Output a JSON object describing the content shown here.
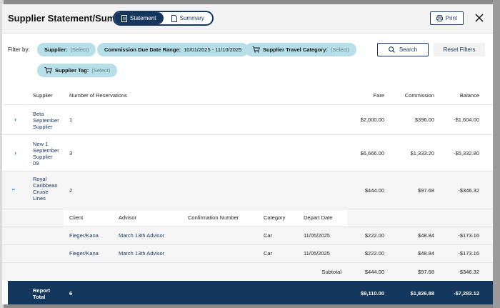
{
  "header": {
    "title": "Supplier Statement/Summary",
    "tabs": [
      {
        "label": "Statement",
        "active": true
      },
      {
        "label": "Summary",
        "active": false
      }
    ],
    "print_label": "Print"
  },
  "filters": {
    "label": "Filter by:",
    "supplier": {
      "label": "Supplier:",
      "value": "(Select)"
    },
    "date_range": {
      "label": "Commission Due Date Range:",
      "value": "10/01/2025 - 11/10/2025"
    },
    "travel_category": {
      "label": "Supplier Travel Category:",
      "value": "(Select)"
    },
    "tag": {
      "label": "Supplier Tag:",
      "value": "(Select)"
    },
    "search_label": "Search",
    "reset_label": "Reset Filters"
  },
  "table": {
    "columns": {
      "supplier": "Supplier",
      "reservations": "Number of Reservations",
      "fare": "Fare",
      "commission": "Commission",
      "balance": "Balance"
    },
    "rows": [
      {
        "supplier": [
          "Beta",
          "September",
          "Supplier"
        ],
        "reservations": "1",
        "fare": "$2,000.00",
        "commission": "$396.00",
        "balance": "-$1,604.00"
      },
      {
        "supplier": [
          "New 1",
          "September",
          "Supplier",
          "09"
        ],
        "reservations": "3",
        "fare": "$6,666.00",
        "commission": "$1,333.20",
        "balance": "-$5,332.80"
      },
      {
        "supplier": [
          "Royal",
          "Caribbean",
          "Cruise",
          "Lines"
        ],
        "reservations": "2",
        "fare": "$444.00",
        "commission": "$97.68",
        "balance": "-$346.32"
      }
    ],
    "detail": {
      "columns": {
        "client": "Client",
        "advisor": "Advisor",
        "confirmation": "Confirmation Number",
        "category": "Category",
        "depart": "Depart Date"
      },
      "rows": [
        {
          "client": "Fieger/Kana",
          "advisor": "March 13th Advisor",
          "confirmation": "",
          "category": "Car",
          "depart": "11/05/2025",
          "fare": "$222.00",
          "commission": "$48.84",
          "balance": "-$173.16"
        },
        {
          "client": "Fieger/Kana",
          "advisor": "March 13th Advisor",
          "confirmation": "",
          "category": "Car",
          "depart": "11/05/2025",
          "fare": "$222.00",
          "commission": "$48.84",
          "balance": "-$173.16"
        }
      ],
      "subtotal": {
        "label": "Subtotal",
        "fare": "$444.00",
        "commission": "$97.68",
        "balance": "-$346.32"
      }
    },
    "report_total": {
      "label": [
        "Report",
        "Total"
      ],
      "reservations": "6",
      "fare": "$9,110.00",
      "commission": "$1,826.88",
      "balance": "-$7,283.12"
    }
  },
  "colors": {
    "navy": "#14375e",
    "chip": "#b7dfe9",
    "accent": "#1a8fb0"
  }
}
